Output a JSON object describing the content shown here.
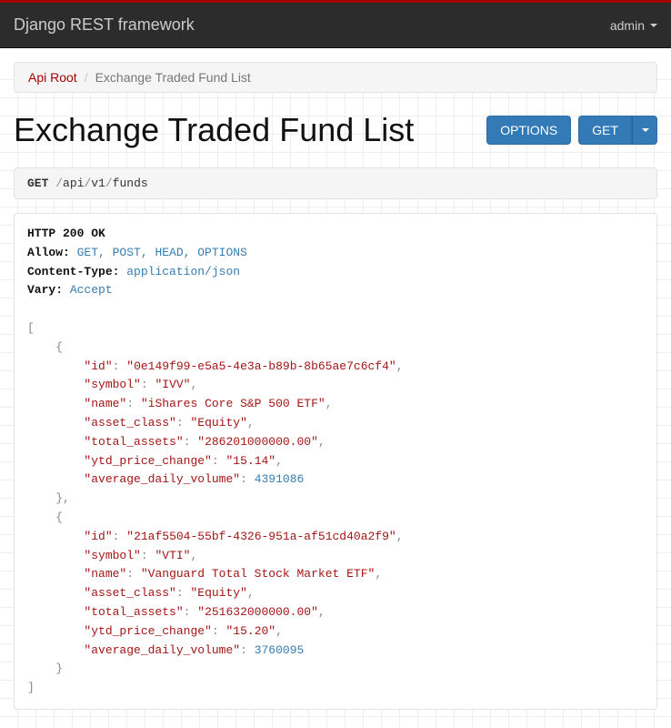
{
  "navbar": {
    "brand": "Django REST framework",
    "user": "admin"
  },
  "breadcrumb": {
    "root": "Api Root",
    "current": "Exchange Traded Fund List"
  },
  "page": {
    "title": "Exchange Traded Fund List"
  },
  "buttons": {
    "options": "OPTIONS",
    "get": "GET"
  },
  "request": {
    "method": "GET",
    "path_segments": [
      "api",
      "v1",
      "funds"
    ]
  },
  "response": {
    "status": "HTTP 200 OK",
    "headers": {
      "allow_label": "Allow:",
      "allow_value": "GET, POST, HEAD, OPTIONS",
      "content_type_label": "Content-Type:",
      "content_type_value": "application/json",
      "vary_label": "Vary:",
      "vary_value": "Accept"
    },
    "body": [
      {
        "id": "0e149f99-e5a5-4e3a-b89b-8b65ae7c6cf4",
        "symbol": "IVV",
        "name": "iShares Core S&P 500 ETF",
        "asset_class": "Equity",
        "total_assets": "286201000000.00",
        "ytd_price_change": "15.14",
        "average_daily_volume": 4391086
      },
      {
        "id": "21af5504-55bf-4326-951a-af51cd40a2f9",
        "symbol": "VTI",
        "name": "Vanguard Total Stock Market ETF",
        "asset_class": "Equity",
        "total_assets": "251632000000.00",
        "ytd_price_change": "15.20",
        "average_daily_volume": 3760095
      }
    ]
  }
}
